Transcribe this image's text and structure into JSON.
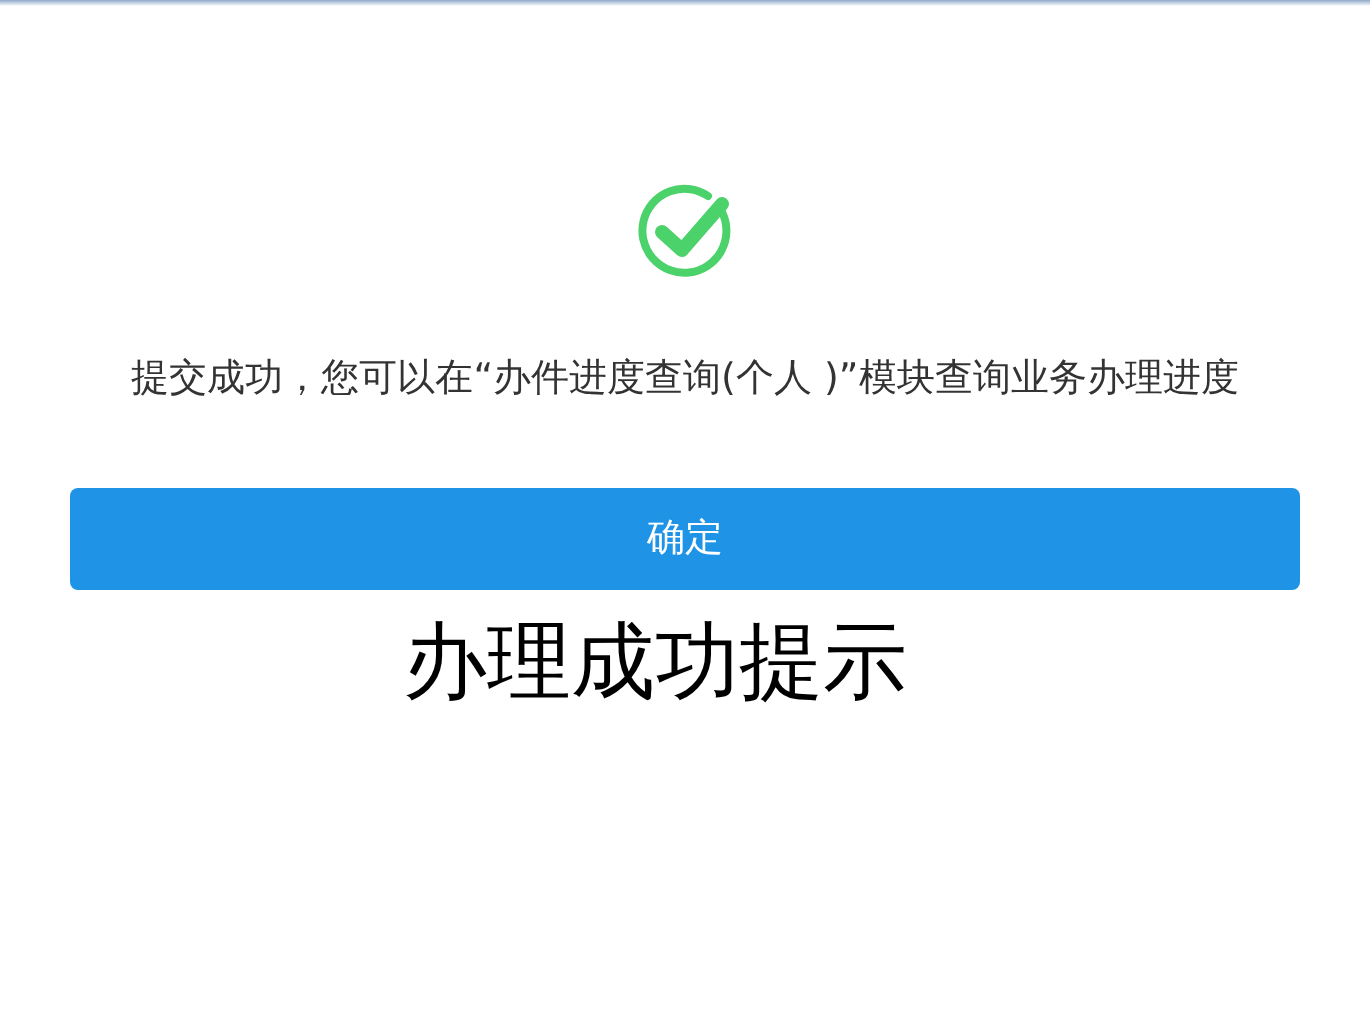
{
  "message": "提交成功，您可以在“办件进度查询(个人 )”模块查询业务办理进度",
  "button": {
    "label": "确定"
  },
  "caption": "办理成功提示"
}
